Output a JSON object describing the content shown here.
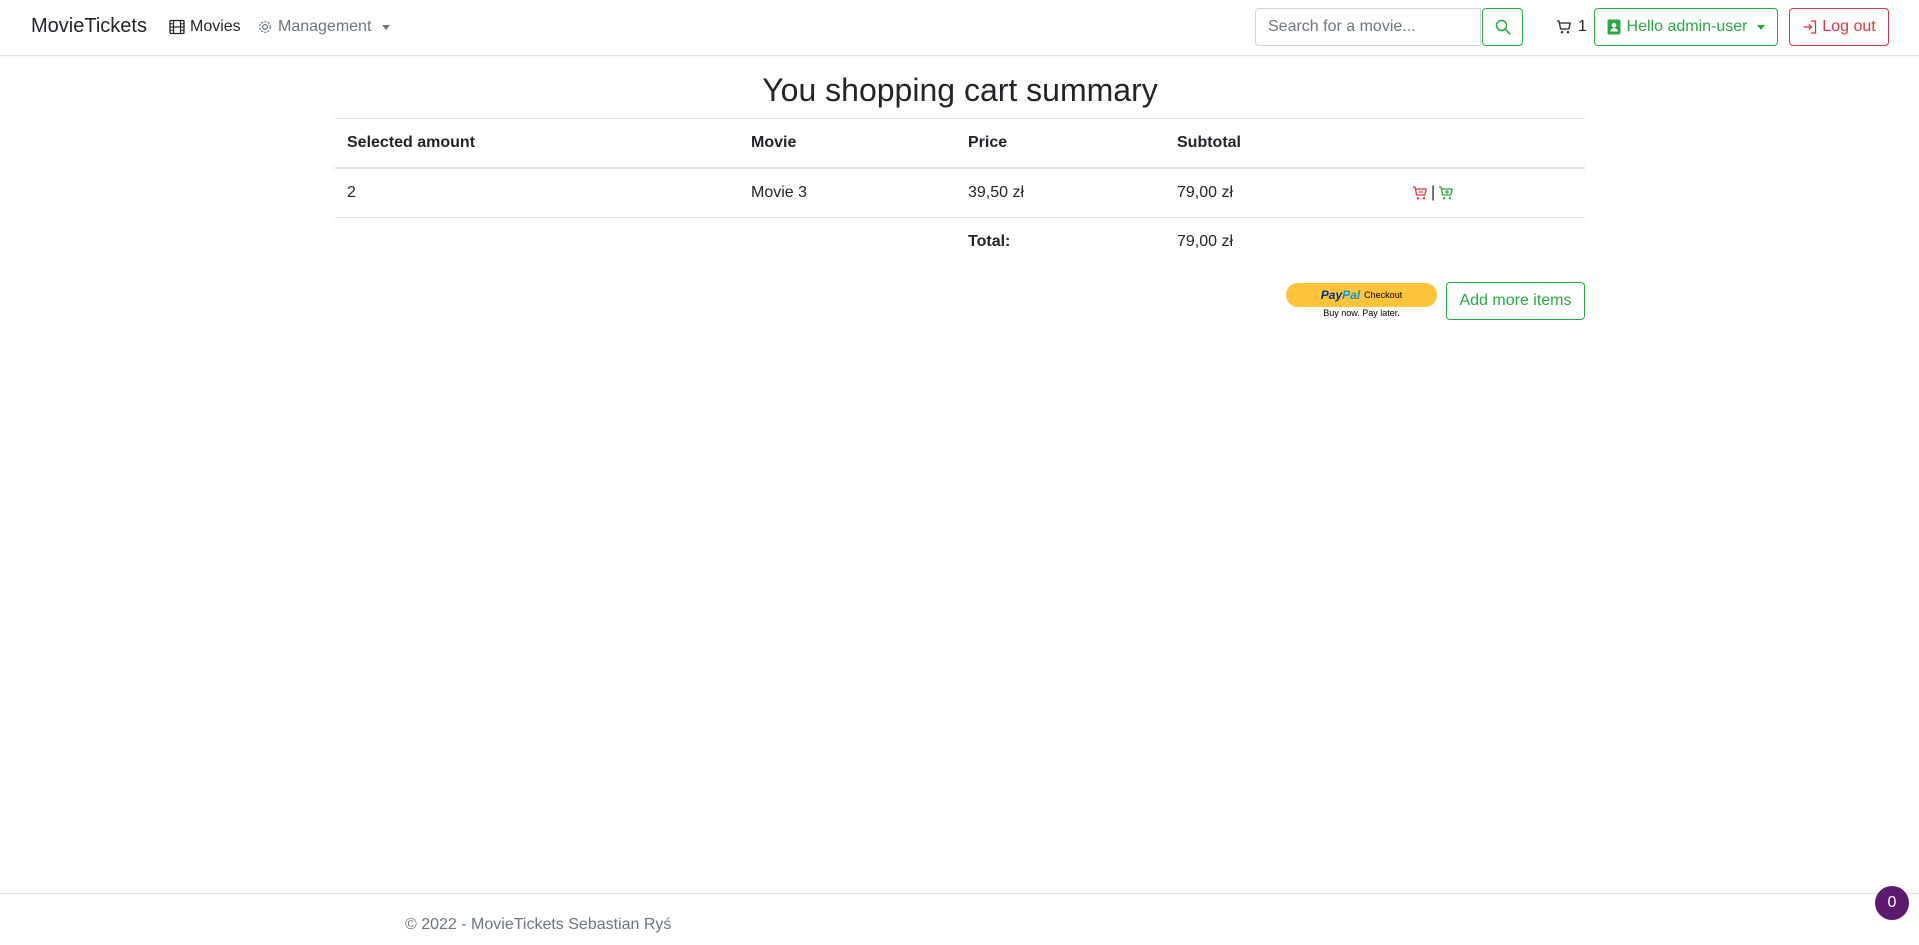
{
  "navbar": {
    "brand": "MovieTickets",
    "movies_label": "Movies",
    "management_label": "Management",
    "search_placeholder": "Search for a movie...",
    "cart_count": "1",
    "user_label": "Hello admin-user",
    "logout_label": "Log out"
  },
  "page": {
    "title": "You shopping cart summary"
  },
  "table": {
    "headers": [
      "Selected amount",
      "Movie",
      "Price",
      "Subtotal"
    ],
    "rows": [
      {
        "amount": "2",
        "movie": "Movie 3",
        "price": "39,50 zł",
        "subtotal": "79,00 zł"
      }
    ],
    "total_label": "Total:",
    "total_value": "79,00 zł",
    "action_separator": "|"
  },
  "checkout": {
    "paypal_pay": "Pay",
    "paypal_pal": "Pal",
    "paypal_checkout": "Checkout",
    "paypal_subtext": "Buy now. Pay later.",
    "add_more_label": "Add more items"
  },
  "footer": {
    "text": "© 2022 - MovieTickets Sebastian Ryś"
  },
  "widget": {
    "badge": "0"
  },
  "colors": {
    "success": "#28a745",
    "danger": "#dc3545",
    "paypal_yellow": "#ffc439",
    "widget_purple": "#5c1a6e"
  }
}
